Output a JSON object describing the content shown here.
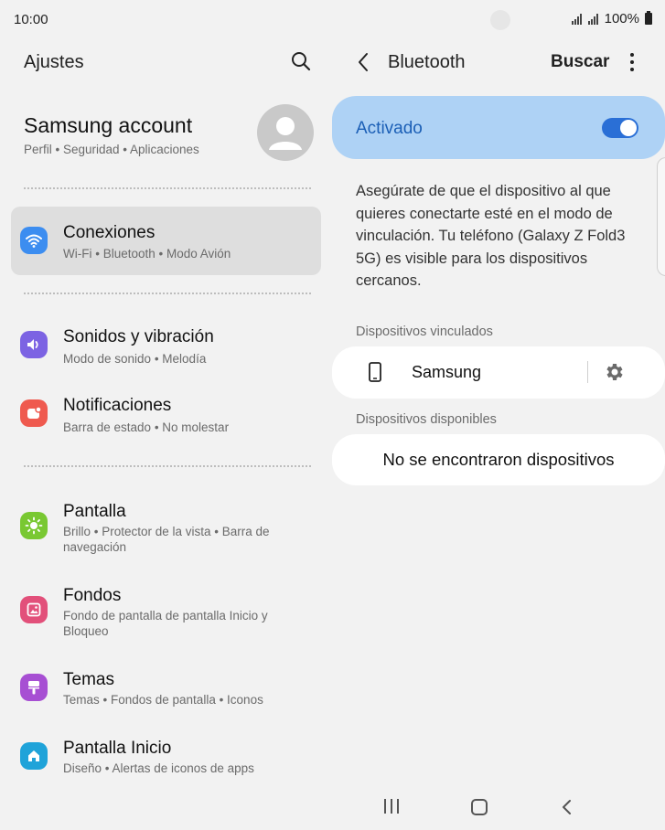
{
  "status_bar": {
    "time": "10:00",
    "battery": "100%"
  },
  "left": {
    "title": "Ajustes",
    "account": {
      "name": "Samsung account",
      "subtitle": "Perfil • Seguridad • Aplicaciones"
    },
    "items": [
      {
        "title": "Conexiones",
        "subtitle": "Wi-Fi • Bluetooth • Modo Avión",
        "icon": "wifi-icon",
        "color": "#3c8df0"
      },
      {
        "title": "Sonidos y vibración",
        "subtitle": "Modo de sonido • Melodía",
        "icon": "volume-icon",
        "color": "#7c63e3"
      },
      {
        "title": "Notificaciones",
        "subtitle": "Barra de estado • No molestar",
        "icon": "notification-icon",
        "color": "#ef5a4f"
      },
      {
        "title": "Pantalla",
        "subtitle": "Brillo • Protector de la vista • Barra de navegación",
        "icon": "brightness-icon",
        "color": "#79c832"
      },
      {
        "title": "Fondos",
        "subtitle": "Fondo de pantalla de pantalla Inicio y Bloqueo",
        "icon": "wallpaper-icon",
        "color": "#e2507a"
      },
      {
        "title": "Temas",
        "subtitle": "Temas • Fondos de pantalla • Iconos",
        "icon": "theme-brush-icon",
        "color": "#a74fd3"
      },
      {
        "title": "Pantalla Inicio",
        "subtitle": "Diseño • Alertas de iconos de apps",
        "icon": "home-icon",
        "color": "#1fa3d9"
      }
    ]
  },
  "right": {
    "title": "Bluetooth",
    "search_label": "Buscar",
    "toggle_label": "Activado",
    "toggle_state": "on",
    "accent_color": "#2a6fd6",
    "description": "Asegúrate de que el dispositivo al que quieres conectarte esté en el modo de vinculación. Tu teléfono (Galaxy Z Fold3 5G) es visible para los dispositivos cercanos.",
    "paired_label": "Dispositivos vinculados",
    "paired_devices": [
      {
        "name": "Samsung"
      }
    ],
    "available_label": "Dispositivos disponibles",
    "available_empty": "No se encontraron dispositivos"
  }
}
